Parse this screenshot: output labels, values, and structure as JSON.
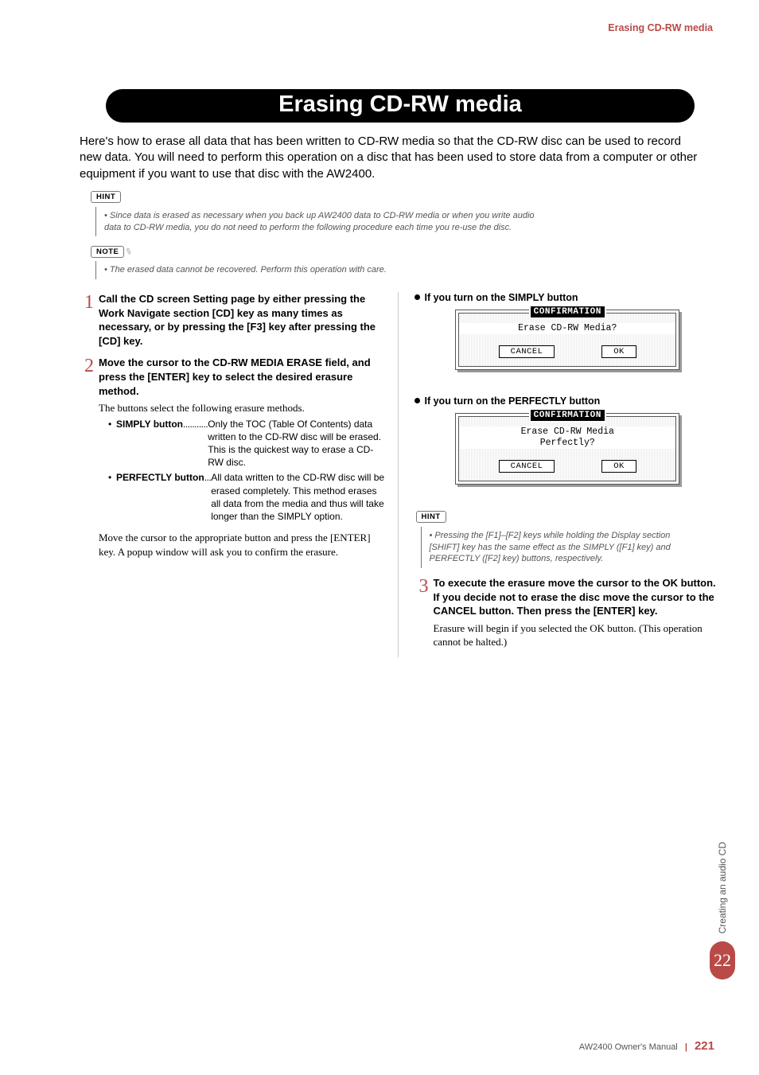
{
  "header": {
    "section_title": "Erasing CD-RW media"
  },
  "title": "Erasing CD-RW media",
  "intro": "Here's how to erase all data that has been written to CD-RW media so that the CD-RW disc can be used to record new data. You will need to perform this operation on a disc that has been used to store data from a computer or other equipment if you want to use that disc with the AW2400.",
  "hint1": {
    "label": "HINT",
    "text": "Since data is erased as necessary when you back up AW2400 data to CD-RW media or when you write audio data to CD-RW media, you do not need to perform the following procedure each time you re-use the disc."
  },
  "note1": {
    "label": "NOTE",
    "text": "The erased data cannot be recovered. Perform this operation with care."
  },
  "step1": {
    "n": "1",
    "head": "Call the CD screen Setting page by either pressing the Work Navigate section [CD] key as many times as necessary, or by pressing the [F3] key after pressing the [CD] key."
  },
  "step2": {
    "n": "2",
    "head": "Move the cursor to the CD-RW MEDIA ERASE field, and press the [ENTER] key to select the desired erasure method.",
    "text": "The buttons select the following erasure methods.",
    "simply_label": "SIMPLY button",
    "simply_dots": "...........",
    "simply_desc": "Only the TOC (Table Of Contents) data written to the CD-RW disc will be erased. This is the quickest way to erase a CD-RW disc.",
    "perfectly_label": "PERFECTLY button",
    "perfectly_dots": "...",
    "perfectly_desc": "All data written to the CD-RW disc will be erased completely. This method erases all data from the media and thus will take longer than the SIMPLY option.",
    "tail": "Move the cursor to the appropriate button and press the [ENTER] key. A popup window will ask you to confirm the erasure."
  },
  "right": {
    "simply_head": "If you turn on the SIMPLY button",
    "perfectly_head": "If you turn on the PERFECTLY button",
    "dialog_title": "CONFIRMATION",
    "dialog_simply_msg": "Erase CD-RW Media?",
    "dialog_perfectly_msg1": "Erase CD-RW Media",
    "dialog_perfectly_msg2": "Perfectly?",
    "btn_cancel": "CANCEL",
    "btn_ok": "OK",
    "hint2_label": "HINT",
    "hint2_text": "Pressing the [F1]–[F2] keys while holding the Display section [SHIFT] key has the same effect as the SIMPLY ([F1] key) and PERFECTLY ([F2] key) buttons, respectively."
  },
  "step3": {
    "n": "3",
    "head": "To execute the erasure move the cursor to the OK button. If you decide not to erase the disc move the cursor to the CANCEL button. Then press the [ENTER] key.",
    "text": "Erasure will begin if you selected the OK button. (This operation cannot be halted.)"
  },
  "side": {
    "label": "Creating an audio CD",
    "num": "22"
  },
  "footer": {
    "manual": "AW2400  Owner's Manual",
    "page": "221"
  }
}
